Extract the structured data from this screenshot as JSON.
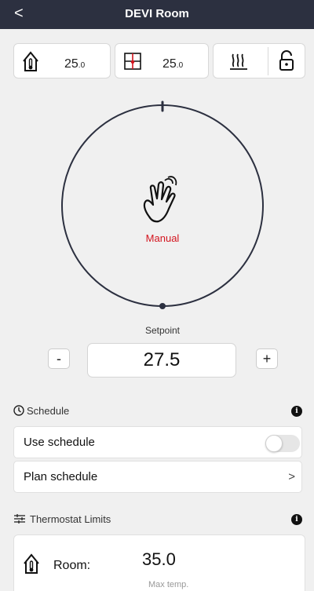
{
  "header": {
    "title": "DEVI Room",
    "back_icon": "<"
  },
  "tiles": {
    "room_temp": {
      "value": "25",
      "decimal": ".0"
    },
    "floor_temp": {
      "value": "25",
      "decimal": ".0"
    }
  },
  "dial": {
    "mode_label": "Manual"
  },
  "setpoint": {
    "label": "Setpoint",
    "value": "27.5",
    "minus": "-",
    "plus": "+"
  },
  "schedule": {
    "title": "Schedule",
    "use_schedule_label": "Use schedule",
    "plan_schedule_label": "Plan schedule",
    "chevron": ">"
  },
  "limits": {
    "title": "Thermostat Limits",
    "room_label": "Room:",
    "max_value": "35.0",
    "max_label": "Max temp."
  },
  "info_glyph": "i",
  "colors": {
    "header": "#2c3040",
    "accent": "#d4141e",
    "dial": "#2c3040"
  }
}
